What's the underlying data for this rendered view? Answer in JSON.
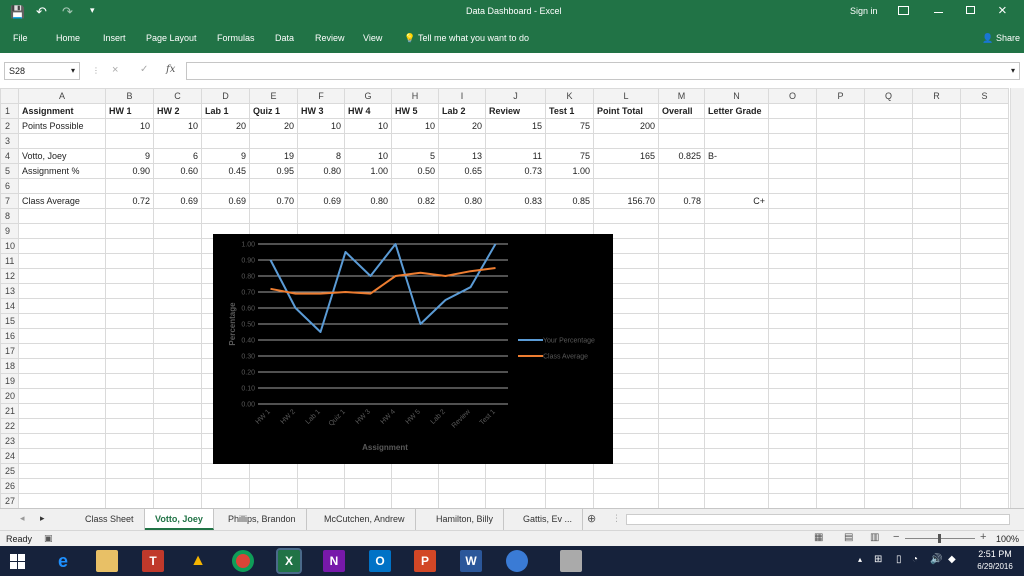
{
  "window": {
    "title": "Data Dashboard - Excel",
    "sign_in": "Sign in"
  },
  "qat": {
    "save": "💾",
    "undo": "↶",
    "redo": "↷",
    "customize": "▾"
  },
  "ribbon": {
    "tabs": [
      "File",
      "Home",
      "Insert",
      "Page Layout",
      "Formulas",
      "Data",
      "Review",
      "View"
    ],
    "tell_me": "Tell me what you want to do",
    "share": "Share"
  },
  "formula_bar": {
    "name_box": "S28",
    "fx": "fx",
    "value": ""
  },
  "columns": [
    "A",
    "B",
    "C",
    "D",
    "E",
    "F",
    "G",
    "H",
    "I",
    "J",
    "K",
    "L",
    "M",
    "N",
    "O",
    "P",
    "Q",
    "R",
    "S"
  ],
  "rows": [
    [
      "Assignment",
      "HW 1",
      "HW 2",
      "Lab 1",
      "Quiz 1",
      "HW 3",
      "HW 4",
      "HW 5",
      "Lab 2",
      "Review",
      "Test 1",
      "Point Total",
      "Overall",
      "Letter Grade",
      "",
      "",
      "",
      "",
      ""
    ],
    [
      "Points Possible",
      "10",
      "10",
      "20",
      "20",
      "10",
      "10",
      "10",
      "20",
      "15",
      "75",
      "200",
      "",
      "",
      "",
      "",
      "",
      "",
      ""
    ],
    [
      "",
      "",
      "",
      "",
      "",
      "",
      "",
      "",
      "",
      "",
      "",
      "",
      "",
      "",
      "",
      "",
      "",
      "",
      ""
    ],
    [
      "Votto, Joey",
      "9",
      "6",
      "9",
      "19",
      "8",
      "10",
      "5",
      "13",
      "11",
      "75",
      "165",
      "0.825",
      "B-",
      "",
      "",
      "",
      "",
      ""
    ],
    [
      "Assignment %",
      "0.90",
      "0.60",
      "0.45",
      "0.95",
      "0.80",
      "1.00",
      "0.50",
      "0.65",
      "0.73",
      "1.00",
      "",
      "",
      "",
      "",
      "",
      "",
      "",
      ""
    ],
    [
      "",
      "",
      "",
      "",
      "",
      "",
      "",
      "",
      "",
      "",
      "",
      "",
      "",
      "",
      "",
      "",
      "",
      "",
      ""
    ],
    [
      "Class Average",
      "0.72",
      "0.69",
      "0.69",
      "0.70",
      "0.69",
      "0.80",
      "0.82",
      "0.80",
      "0.83",
      "0.85",
      "156.70",
      "0.78",
      "C+",
      "",
      "",
      "",
      "",
      ""
    ],
    [
      "",
      "",
      "",
      "",
      "",
      "",
      "",
      "",
      "",
      "",
      "",
      "",
      "",
      "",
      "",
      "",
      "",
      "",
      ""
    ],
    [
      "",
      "",
      "",
      "",
      "",
      "",
      "",
      "",
      "",
      "",
      "",
      "",
      "",
      "",
      "",
      "",
      "",
      "",
      ""
    ],
    [
      "",
      "",
      "",
      "",
      "",
      "",
      "",
      "",
      "",
      "",
      "",
      "",
      "",
      "",
      "",
      "",
      "",
      "",
      ""
    ],
    [
      "",
      "",
      "",
      "",
      "",
      "",
      "",
      "",
      "",
      "",
      "",
      "",
      "",
      "",
      "",
      "",
      "",
      "",
      ""
    ],
    [
      "",
      "",
      "",
      "",
      "",
      "",
      "",
      "",
      "",
      "",
      "",
      "",
      "",
      "",
      "",
      "",
      "",
      "",
      ""
    ],
    [
      "",
      "",
      "",
      "",
      "",
      "",
      "",
      "",
      "",
      "",
      "",
      "",
      "",
      "",
      "",
      "",
      "",
      "",
      ""
    ],
    [
      "",
      "",
      "",
      "",
      "",
      "",
      "",
      "",
      "",
      "",
      "",
      "",
      "",
      "",
      "",
      "",
      "",
      "",
      ""
    ],
    [
      "",
      "",
      "",
      "",
      "",
      "",
      "",
      "",
      "",
      "",
      "",
      "",
      "",
      "",
      "",
      "",
      "",
      "",
      ""
    ],
    [
      "",
      "",
      "",
      "",
      "",
      "",
      "",
      "",
      "",
      "",
      "",
      "",
      "",
      "",
      "",
      "",
      "",
      "",
      ""
    ],
    [
      "",
      "",
      "",
      "",
      "",
      "",
      "",
      "",
      "",
      "",
      "",
      "",
      "",
      "",
      "",
      "",
      "",
      "",
      ""
    ],
    [
      "",
      "",
      "",
      "",
      "",
      "",
      "",
      "",
      "",
      "",
      "",
      "",
      "",
      "",
      "",
      "",
      "",
      "",
      ""
    ],
    [
      "",
      "",
      "",
      "",
      "",
      "",
      "",
      "",
      "",
      "",
      "",
      "",
      "",
      "",
      "",
      "",
      "",
      "",
      ""
    ],
    [
      "",
      "",
      "",
      "",
      "",
      "",
      "",
      "",
      "",
      "",
      "",
      "",
      "",
      "",
      "",
      "",
      "",
      "",
      ""
    ],
    [
      "",
      "",
      "",
      "",
      "",
      "",
      "",
      "",
      "",
      "",
      "",
      "",
      "",
      "",
      "",
      "",
      "",
      "",
      ""
    ],
    [
      "",
      "",
      "",
      "",
      "",
      "",
      "",
      "",
      "",
      "",
      "",
      "",
      "",
      "",
      "",
      "",
      "",
      "",
      ""
    ],
    [
      "",
      "",
      "",
      "",
      "",
      "",
      "",
      "",
      "",
      "",
      "",
      "",
      "",
      "",
      "",
      "",
      "",
      "",
      ""
    ],
    [
      "",
      "",
      "",
      "",
      "",
      "",
      "",
      "",
      "",
      "",
      "",
      "",
      "",
      "",
      "",
      "",
      "",
      "",
      ""
    ],
    [
      "",
      "",
      "",
      "",
      "",
      "",
      "",
      "",
      "",
      "",
      "",
      "",
      "",
      "",
      "",
      "",
      "",
      "",
      ""
    ],
    [
      "",
      "",
      "",
      "",
      "",
      "",
      "",
      "",
      "",
      "",
      "",
      "",
      "",
      "",
      "",
      "",
      "",
      "",
      ""
    ],
    [
      "",
      "",
      "",
      "",
      "",
      "",
      "",
      "",
      "",
      "",
      "",
      "",
      "",
      "",
      "",
      "",
      "",
      "",
      ""
    ]
  ],
  "chart_data": {
    "type": "line",
    "categories": [
      "HW 1",
      "HW 2",
      "Lab 1",
      "Quiz 1",
      "HW 3",
      "HW 4",
      "HW 5",
      "Lab 2",
      "Review",
      "Test 1"
    ],
    "series": [
      {
        "name": "Your Percentage",
        "color": "#5b9bd5",
        "values": [
          0.9,
          0.6,
          0.45,
          0.95,
          0.8,
          1.0,
          0.5,
          0.65,
          0.73,
          1.0
        ]
      },
      {
        "name": "Class Average",
        "color": "#ed7d31",
        "values": [
          0.72,
          0.69,
          0.69,
          0.7,
          0.69,
          0.8,
          0.82,
          0.8,
          0.83,
          0.85
        ]
      }
    ],
    "title": "",
    "xlabel": "Assignment",
    "ylabel": "Percentage",
    "ylim": [
      0,
      1
    ],
    "yticks": [
      "0.00",
      "0.10",
      "0.20",
      "0.30",
      "0.40",
      "0.50",
      "0.60",
      "0.70",
      "0.80",
      "0.90",
      "1.00"
    ],
    "grid": true,
    "legend": "right",
    "background": "#000000"
  },
  "sheet_tabs": [
    "Class Sheet",
    "Votto, Joey",
    "Phillips, Brandon",
    "McCutchen, Andrew",
    "Hamilton, Billy",
    "Gattis, Ev ..."
  ],
  "active_sheet": "Votto, Joey",
  "status": {
    "ready": "Ready",
    "zoom": "100%"
  },
  "taskbar": {
    "time": "2:51 PM",
    "date": "6/29/2016"
  },
  "colors": {
    "excel_green": "#217346"
  }
}
